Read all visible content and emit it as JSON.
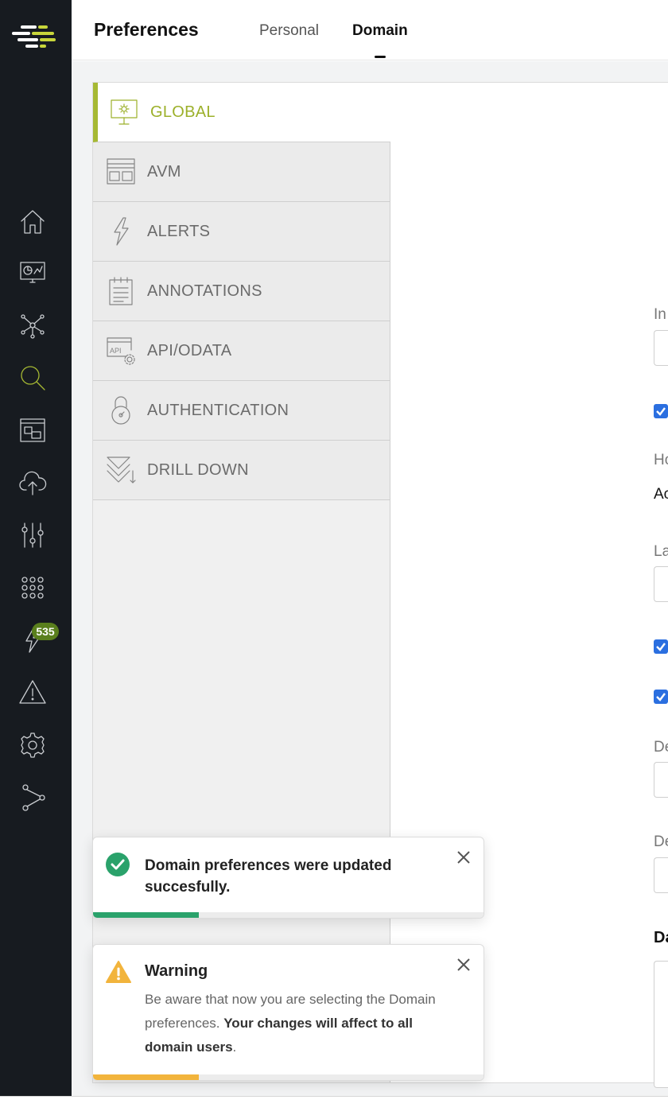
{
  "header": {
    "title": "Preferences",
    "tabs": [
      {
        "label": "Personal",
        "active": false
      },
      {
        "label": "Domain",
        "active": true
      }
    ]
  },
  "sidebar": {
    "notification_count": "535",
    "icons": [
      "home-icon",
      "dashboard-icon",
      "topology-icon",
      "search-icon",
      "layout-icon",
      "cloud-upload-icon",
      "sliders-icon",
      "apps-grid-icon",
      "alerts-icon",
      "warning-icon",
      "settings-icon",
      "share-icon"
    ],
    "accent": "#a6b933"
  },
  "menu": {
    "items": [
      {
        "label": "GLOBAL",
        "icon": "monitor-gear-icon",
        "active": true
      },
      {
        "label": "AVM",
        "icon": "layout-window-icon",
        "active": false
      },
      {
        "label": "ALERTS",
        "icon": "lightning-icon",
        "active": false
      },
      {
        "label": "ANNOTATIONS",
        "icon": "notepad-icon",
        "active": false
      },
      {
        "label": "API/ODATA",
        "icon": "api-gear-icon",
        "active": false
      },
      {
        "label": "AUTHENTICATION",
        "icon": "padlock-icon",
        "active": false
      },
      {
        "label": "DRILL DOWN",
        "icon": "drill-down-icon",
        "active": false
      }
    ]
  },
  "form_fragments": {
    "f1": "In",
    "f2": "Ho",
    "f3": "Ac",
    "f4": "La",
    "f5": "De",
    "f6": "De",
    "f7": "Da"
  },
  "toasts": {
    "success": {
      "message": "Domain preferences were updated succesfully.",
      "color": "#2aa26b",
      "progress": 0.27
    },
    "warning": {
      "title": "Warning",
      "body_prefix": "Be aware that now you are selecting the Domain preferences. ",
      "body_bold": "Your changes will affect to all domain users",
      "body_suffix": ".",
      "color": "#f2b43c",
      "progress": 0.27
    }
  }
}
